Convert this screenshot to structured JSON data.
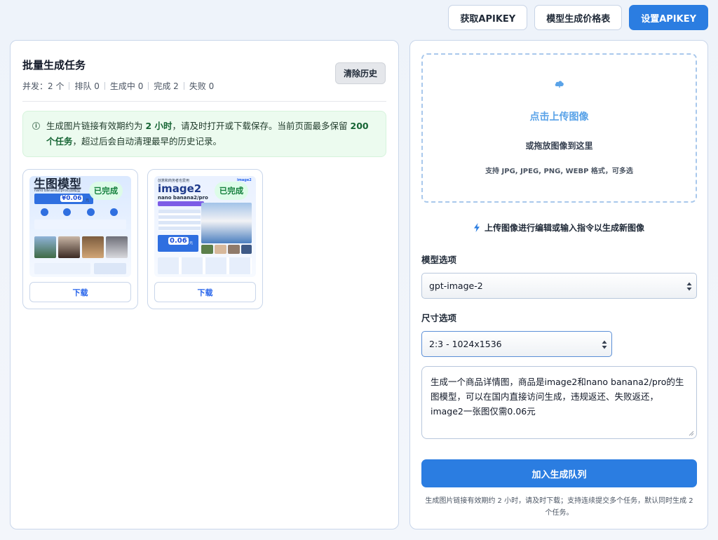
{
  "topbar": {
    "get_apikey": "获取APIKEY",
    "price_table": "模型生成价格表",
    "set_apikey": "设置APIKEY"
  },
  "tasks": {
    "title": "批量生成任务",
    "clear_label": "清除历史",
    "stats": {
      "concurrency": "并发：2 个",
      "queued": "排队 0",
      "generating": "生成中 0",
      "done": "完成 2",
      "failed": "失败 0"
    },
    "notice": {
      "icon": "info-icon",
      "part1": "生成图片链接有效期约为 ",
      "bold1": "2 小时",
      "part2": "，请及时打开或下载保存。当前页面最多保留 ",
      "bold2": "200 个任务",
      "part3": "，超过后会自动清理最早的历史记录。"
    },
    "cards": [
      {
        "status": "已完成",
        "download_label": "下载",
        "thumb": {
          "headline": "生图模型",
          "subline": "nano banana2/pro同源模型",
          "price": "¥0.06",
          "price_unit": "元"
        }
      },
      {
        "status": "已完成",
        "download_label": "下载",
        "thumb": {
          "tagline": "创意和商务者也爱用",
          "headline": "image2",
          "subline": "nano banana2/pro",
          "corner": "image2",
          "price": "0.06",
          "price_unit": "元"
        }
      }
    ]
  },
  "upload": {
    "title": "点击上传图像",
    "subtitle": "或拖放图像到这里",
    "formats": "支持 JPG, JPEG, PNG, WEBP 格式，可多选"
  },
  "hint": "上传图像进行编辑或输入指令以生成新图像",
  "model": {
    "label": "模型选项",
    "selected": "gpt-image-2"
  },
  "size": {
    "label": "尺寸选项",
    "selected": "2:3 - 1024x1536"
  },
  "prompt": {
    "value": "生成一个商品详情图，商品是image2和nano banana2/pro的生图模型，可以在国内直接访问生成，违规返还、失败返还，image2一张图仅需0.06元"
  },
  "submit_label": "加入生成队列",
  "footnote": "生成图片链接有效期约 2 小时，请及时下载；支持连续提交多个任务，默认同时生成 2 个任务。",
  "colors": {
    "primary": "#2b7de1",
    "upload_title": "#5aa3e8",
    "success": "#15803d",
    "notice_bg": "#ecfbef"
  }
}
